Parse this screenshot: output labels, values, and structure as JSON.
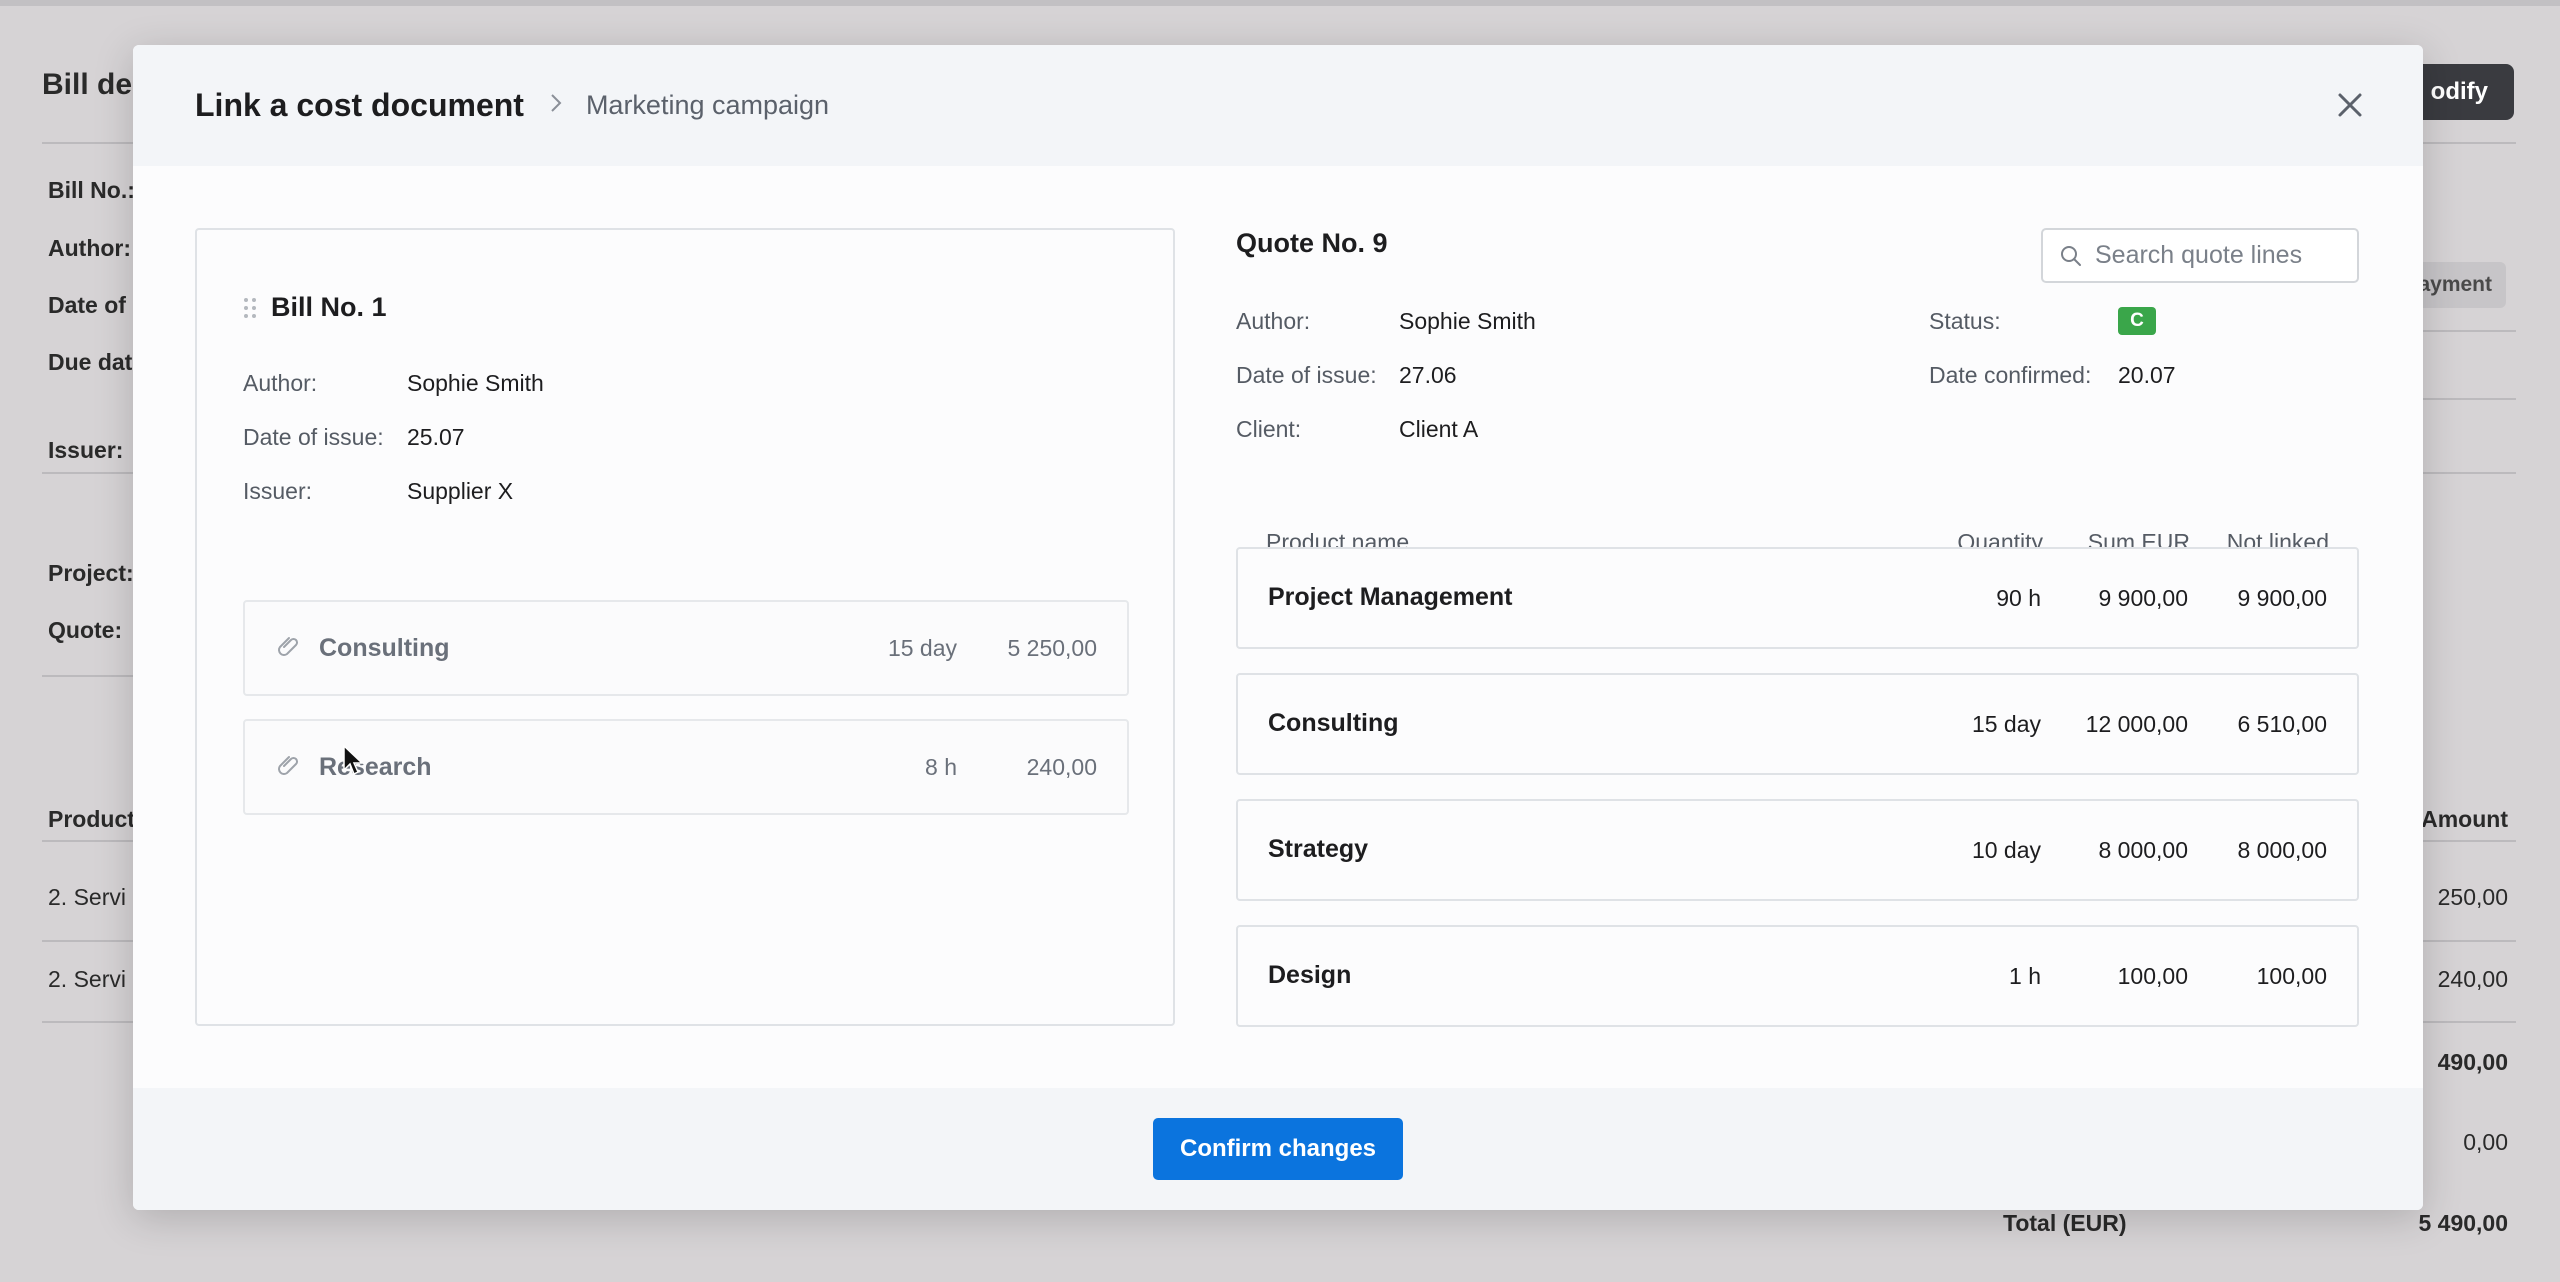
{
  "background": {
    "title": "Bill de",
    "modify_label": "odify",
    "labels": [
      "Bill No.:",
      "Author:",
      "Date of",
      "Due dat",
      "Issuer:",
      "Project:",
      "Quote:"
    ],
    "payment_label": "ayment",
    "product_header": "Product",
    "amount_header": "Amount",
    "rows": [
      {
        "service": "2. Servi",
        "amount": "250,00"
      },
      {
        "service": "2. Servi",
        "amount": "240,00"
      }
    ],
    "subtotal": "490,00",
    "vat": "0,00",
    "total_label": "Total (EUR)",
    "total_value": "5 490,00"
  },
  "modal": {
    "title": "Link a cost document",
    "breadcrumb": "Marketing campaign",
    "confirm_label": "Confirm changes",
    "bill": {
      "title": "Bill No. 1",
      "author_label": "Author:",
      "author": "Sophie Smith",
      "date_label": "Date of issue:",
      "date": "25.07",
      "issuer_label": "Issuer:",
      "issuer": "Supplier X",
      "lines": [
        {
          "name": "Consulting",
          "qty": "15 day",
          "sum": "5 250,00"
        },
        {
          "name": "Research",
          "qty": "8 h",
          "sum": "240,00"
        }
      ]
    },
    "quote": {
      "title": "Quote No. 9",
      "search_placeholder": "Search quote lines",
      "author_label": "Author:",
      "author": "Sophie Smith",
      "date_label": "Date of issue:",
      "date": "27.06",
      "client_label": "Client:",
      "client": "Client A",
      "status_label": "Status:",
      "status": "C",
      "confirmed_label": "Date confirmed:",
      "confirmed": "20.07",
      "columns": {
        "product": "Product name",
        "quantity": "Quantity",
        "sum": "Sum EUR",
        "not_linked": "Not linked"
      },
      "lines": [
        {
          "name": "Project Management",
          "qty": "90 h",
          "sum": "9 900,00",
          "not_linked": "9 900,00"
        },
        {
          "name": "Consulting",
          "qty": "15 day",
          "sum": "12 000,00",
          "not_linked": "6 510,00"
        },
        {
          "name": "Strategy",
          "qty": "10 day",
          "sum": "8 000,00",
          "not_linked": "8 000,00"
        },
        {
          "name": "Design",
          "qty": "1 h",
          "sum": "100,00",
          "not_linked": "100,00"
        }
      ]
    }
  },
  "colors": {
    "accent": "#0b74de",
    "status_confirmed": "#3aa64a"
  }
}
